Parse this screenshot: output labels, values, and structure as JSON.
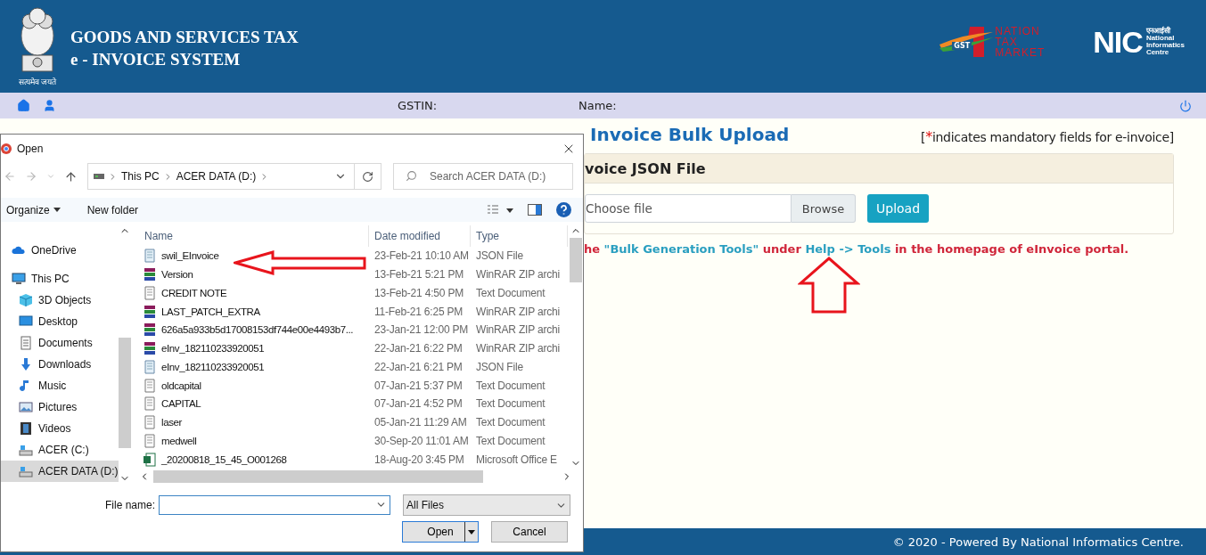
{
  "header": {
    "emblem_motto": "सत्यमेव जयते",
    "title_lines": [
      "GOODS AND SERVICES TAX",
      "e - INVOICE SYSTEM"
    ],
    "gst_logo": {
      "badge": "GST",
      "lines": [
        "NATION",
        "TAX",
        "MARKET"
      ]
    },
    "nic_logo": {
      "mark": "NIC",
      "hindi": "एनआईसी",
      "lines": [
        "National",
        "Informatics",
        "Centre"
      ]
    }
  },
  "nav": {
    "gstin_label": "GSTIN:",
    "name_label": "Name:"
  },
  "page": {
    "title": "Invoice Bulk Upload",
    "mandatory_note": {
      "prefix": "[",
      "star": "*",
      "text": "indicates mandatory fields for e-invoice]"
    },
    "card": {
      "heading": "voice JSON File",
      "file_placeholder": "Choose file",
      "browse": "Browse",
      "upload": "Upload"
    },
    "hint": [
      {
        "kind": "text",
        "text": "he "
      },
      {
        "kind": "link",
        "text": "\"Bulk Generation Tools\""
      },
      {
        "kind": "text",
        "text": " under "
      },
      {
        "kind": "link",
        "text": "Help -> Tools"
      },
      {
        "kind": "text",
        "text": " in the homepage of eInvoice portal."
      }
    ]
  },
  "footer": "© 2020 - Powered By National Informatics Centre.",
  "dialog": {
    "title": "Open",
    "path": [
      "This PC",
      "ACER DATA (D:)"
    ],
    "search_placeholder": "Search ACER DATA (D:)",
    "organize": "Organize",
    "new_folder": "New folder",
    "sidebar": [
      {
        "label": "OneDrive",
        "kind": "cloud",
        "selected": false
      },
      {
        "label": "This PC",
        "kind": "computer",
        "selected": false,
        "children": [
          {
            "label": "3D Objects",
            "kind": "cube",
            "selected": false
          },
          {
            "label": "Desktop",
            "kind": "desktop",
            "selected": false
          },
          {
            "label": "Documents",
            "kind": "documents",
            "selected": false
          },
          {
            "label": "Downloads",
            "kind": "downloads",
            "selected": false
          },
          {
            "label": "Music",
            "kind": "music",
            "selected": false
          },
          {
            "label": "Pictures",
            "kind": "pictures",
            "selected": false
          },
          {
            "label": "Videos",
            "kind": "videos",
            "selected": false
          },
          {
            "label": "ACER (C:)",
            "kind": "drive",
            "selected": false
          },
          {
            "label": "ACER DATA (D:)",
            "kind": "drive",
            "selected": true
          }
        ]
      }
    ],
    "columns": [
      "Name",
      "Date modified",
      "Type"
    ],
    "files": [
      {
        "name": "swil_EInvoice",
        "date": "23-Feb-21 10:10 AM",
        "type": "JSON File",
        "kind": "json"
      },
      {
        "name": "Version",
        "date": "13-Feb-21 5:21 PM",
        "type": "WinRAR ZIP archi",
        "kind": "zip"
      },
      {
        "name": "CREDIT NOTE",
        "date": "13-Feb-21 4:50 PM",
        "type": "Text Document",
        "kind": "text"
      },
      {
        "name": "LAST_PATCH_EXTRA",
        "date": "11-Feb-21 6:25 PM",
        "type": "WinRAR ZIP archi",
        "kind": "zip"
      },
      {
        "name": "626a5a933b5d17008153df744e00e4493b7...",
        "date": "23-Jan-21 12:00 PM",
        "type": "WinRAR ZIP archi",
        "kind": "zip"
      },
      {
        "name": "eInv_182110233920051",
        "date": "22-Jan-21 6:22 PM",
        "type": "WinRAR ZIP archi",
        "kind": "zip"
      },
      {
        "name": "eInv_182110233920051",
        "date": "22-Jan-21 6:21 PM",
        "type": "JSON File",
        "kind": "json"
      },
      {
        "name": "oldcapital",
        "date": "07-Jan-21 5:37 PM",
        "type": "Text Document",
        "kind": "text"
      },
      {
        "name": "CAPITAL",
        "date": "07-Jan-21 4:52 PM",
        "type": "Text Document",
        "kind": "text"
      },
      {
        "name": "laser",
        "date": "05-Jan-21 11:29 AM",
        "type": "Text Document",
        "kind": "text"
      },
      {
        "name": "medwell",
        "date": "30-Sep-20 11:01 AM",
        "type": "Text Document",
        "kind": "text"
      },
      {
        "name": "_20200818_15_45_O001268",
        "date": "18-Aug-20 3:45 PM",
        "type": "Microsoft Office E",
        "kind": "excel"
      }
    ],
    "filename_label": "File name:",
    "filter": "All Files",
    "open": "Open",
    "cancel": "Cancel"
  }
}
